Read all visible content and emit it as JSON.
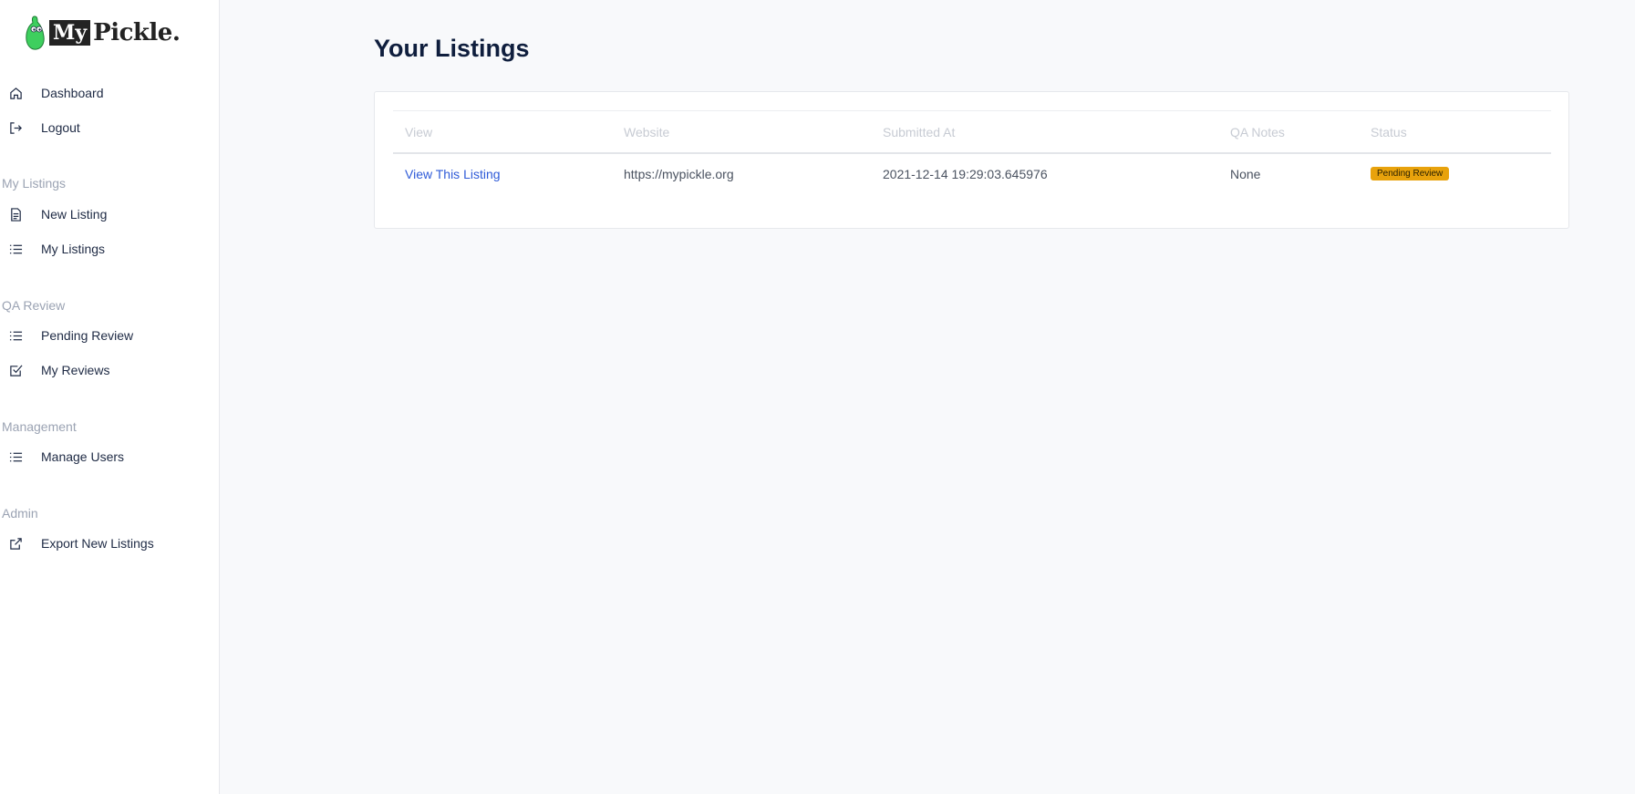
{
  "logo": {
    "my": "My",
    "pickle": "Pickle."
  },
  "sidebar": {
    "top_items": [
      {
        "label": "Dashboard",
        "icon": "home-icon"
      },
      {
        "label": "Logout",
        "icon": "logout-icon"
      }
    ],
    "sections": [
      {
        "title": "My Listings",
        "items": [
          {
            "label": "New Listing",
            "icon": "document-icon"
          },
          {
            "label": "My Listings",
            "icon": "list-icon"
          }
        ]
      },
      {
        "title": "QA Review",
        "items": [
          {
            "label": "Pending Review",
            "icon": "list-icon"
          },
          {
            "label": "My Reviews",
            "icon": "checkbox-icon"
          }
        ]
      },
      {
        "title": "Management",
        "items": [
          {
            "label": "Manage Users",
            "icon": "list-icon"
          }
        ]
      },
      {
        "title": "Admin",
        "items": [
          {
            "label": "Export New Listings",
            "icon": "external-link-icon"
          }
        ]
      }
    ]
  },
  "main": {
    "title": "Your Listings",
    "table": {
      "headers": [
        "View",
        "Website",
        "Submitted At",
        "QA Notes",
        "Status"
      ],
      "rows": [
        {
          "view": "View This Listing",
          "website": "https://mypickle.org",
          "submitted_at": "2021-12-14 19:29:03.645976",
          "qa_notes": "None",
          "status": "Pending Review"
        }
      ]
    }
  },
  "colors": {
    "accent_link": "#2f5bd8",
    "status_pending": "#e8a20c",
    "pickle_green": "#3ecf5e"
  }
}
